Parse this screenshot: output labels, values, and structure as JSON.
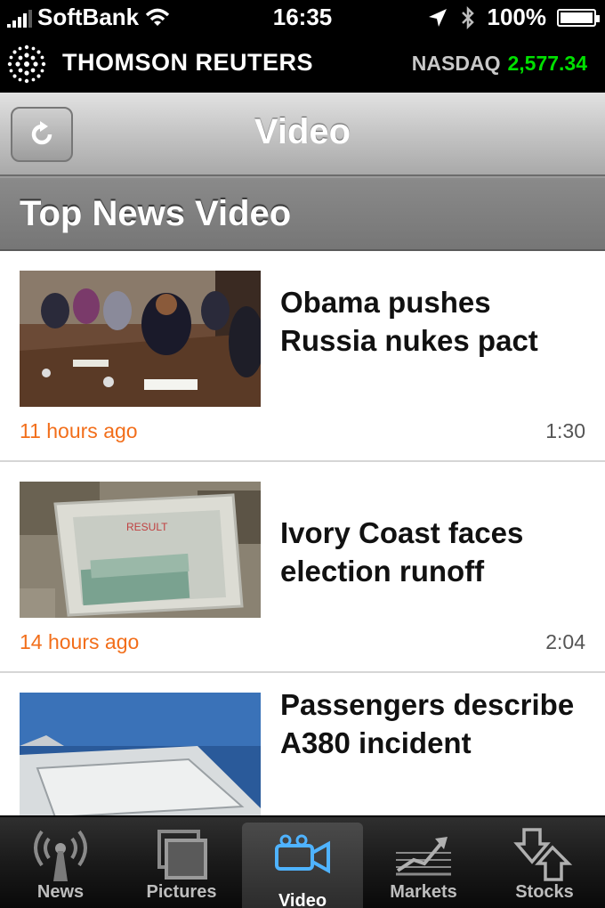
{
  "status_bar": {
    "carrier": "SoftBank",
    "time": "16:35",
    "battery": "100%"
  },
  "brand": {
    "name": "THOMSON REUTERS",
    "ticker_label": "NASDAQ",
    "ticker_value": "2,577.34",
    "ticker_color": "#00e000"
  },
  "nav": {
    "title": "Video",
    "refresh_icon": "refresh-icon"
  },
  "section": {
    "title": "Top News Video"
  },
  "videos": [
    {
      "headline": "Obama pushes Russia nukes pact",
      "time_ago": "11 hours ago",
      "duration": "1:30"
    },
    {
      "headline": "Ivory Coast faces election runoff",
      "time_ago": "14 hours ago",
      "duration": "2:04"
    },
    {
      "headline": "Passengers describe A380 incident",
      "time_ago": "",
      "duration": ""
    }
  ],
  "tabs": [
    {
      "label": "News",
      "icon": "broadcast-icon",
      "active": false
    },
    {
      "label": "Pictures",
      "icon": "pictures-icon",
      "active": false
    },
    {
      "label": "Video",
      "icon": "video-camera-icon",
      "active": true
    },
    {
      "label": "Markets",
      "icon": "markets-chart-icon",
      "active": false
    },
    {
      "label": "Stocks",
      "icon": "stocks-arrows-icon",
      "active": false
    }
  ],
  "colors": {
    "timestamp": "#f26e1a",
    "active_tab_icon": "#4fb3ff"
  }
}
